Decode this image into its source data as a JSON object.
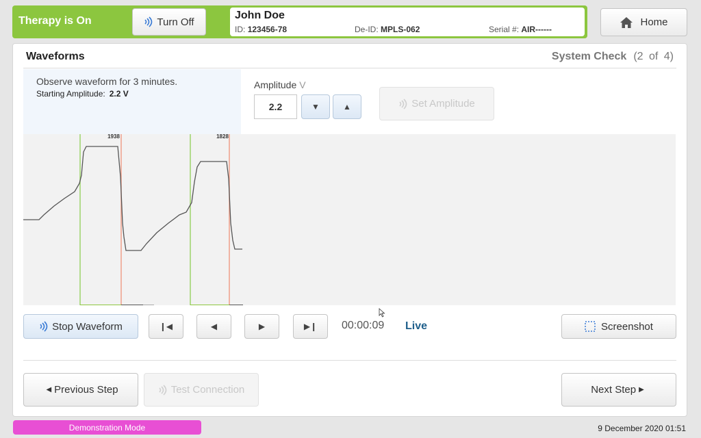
{
  "header": {
    "therapy_status": "Therapy is On",
    "turn_off_label": "Turn Off",
    "home_label": "Home"
  },
  "patient": {
    "name": "John Doe",
    "id_label": "ID:",
    "id_value": "123456-78",
    "deid_label": "De-ID:",
    "deid_value": "MPLS-062",
    "serial_label": "Serial #:",
    "serial_value": "AIR------"
  },
  "panel": {
    "title": "Waveforms",
    "step_label": "System Check",
    "step_count": "(2 of 4)"
  },
  "info": {
    "observe_text": "Observe waveform for 3 minutes.",
    "starting_amp_label": "Starting Amplitude:",
    "starting_amp_value": "2.2 V"
  },
  "amplitude": {
    "label": "Amplitude",
    "unit": "V",
    "value": "2.2",
    "set_label": "Set Amplitude"
  },
  "waveform": {
    "markers": [
      {
        "label": "1938"
      },
      {
        "label": "1828"
      }
    ]
  },
  "playback": {
    "stop_label": "Stop Waveform",
    "elapsed": "00:00:09",
    "mode": "Live",
    "screenshot_label": "Screenshot"
  },
  "navigation": {
    "previous_label": "Previous Step",
    "test_connection_label": "Test Connection",
    "next_label": "Next Step"
  },
  "footer": {
    "mode_label": "Demonstration Mode",
    "datetime": "9 December 2020 01:51"
  },
  "colors": {
    "therapy_on": "#8cc63f",
    "live_text": "#1f5f8b",
    "demo_mode": "#e84fd4"
  }
}
